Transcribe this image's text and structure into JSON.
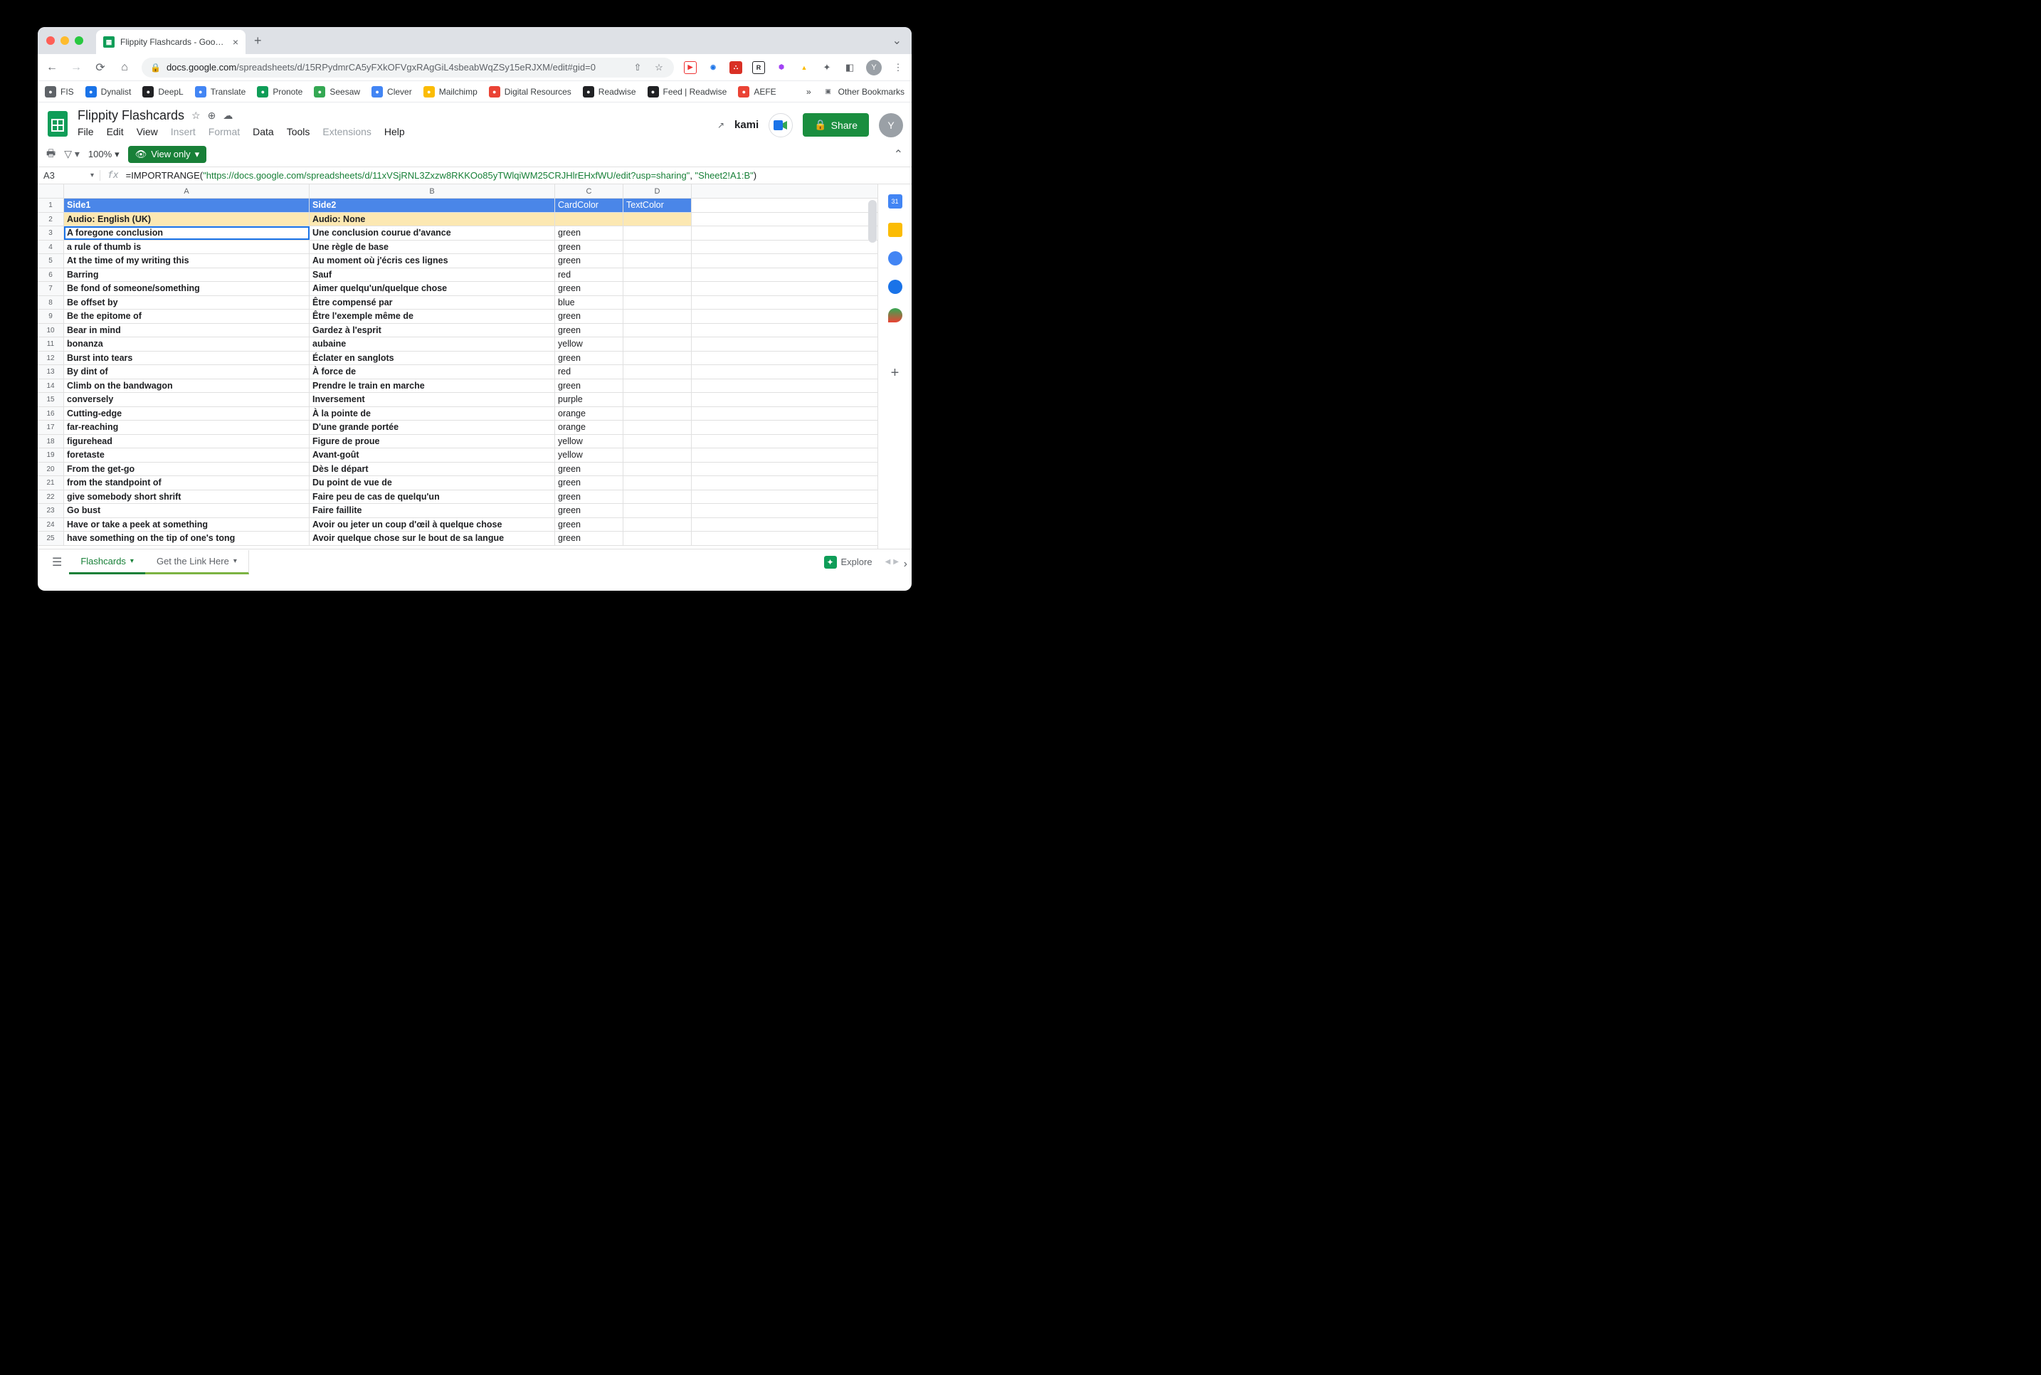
{
  "browser": {
    "tab_title": "Flippity Flashcards - Google Sh",
    "url_host": "docs.google.com",
    "url_path": "/spreadsheets/d/15RPydmrCA5yFXkOFVgxRAgGiL4sbeabWqZSy15eRJXM/edit#gid=0",
    "bookmarks": [
      "FIS",
      "Dynalist",
      "DeepL",
      "Translate",
      "Pronote",
      "Seesaw",
      "Clever",
      "Mailchimp",
      "Digital Resources",
      "Readwise",
      "Feed | Readwise",
      "AEFE"
    ],
    "bookmarks_more": "»",
    "other_bookmarks": "Other Bookmarks",
    "avatar": "Y"
  },
  "sheets": {
    "doc_title": "Flippity Flashcards",
    "menus": [
      "File",
      "Edit",
      "View",
      "Insert",
      "Format",
      "Data",
      "Tools",
      "Extensions",
      "Help"
    ],
    "menus_disabled": [
      "Insert",
      "Format",
      "Extensions"
    ],
    "kami": "kami",
    "share": "Share",
    "zoom": "100%",
    "view_only": "View only",
    "namebox": "A3",
    "formula_prefix": "=IMPORTRANGE(",
    "formula_str1": "\"https://docs.google.com/spreadsheets/d/11xVSjRNL3Zxzw8RKKOo85yTWlqiWM25CRJHlrEHxfWU/edit?usp=sharing\"",
    "formula_sep": ", ",
    "formula_str2": "\"Sheet2!A1:B\"",
    "formula_suffix": ")",
    "columns": [
      "A",
      "B",
      "C",
      "D"
    ],
    "header_row": [
      "Side1",
      "Side2",
      "CardColor",
      "TextColor"
    ],
    "audio_row": [
      "Audio: English (UK)",
      "Audio: None",
      "",
      ""
    ],
    "rows": [
      [
        "A foregone conclusion",
        "Une conclusion courue d'avance",
        "green",
        ""
      ],
      [
        "a rule of thumb is",
        "Une règle de base",
        "green",
        ""
      ],
      [
        "At the time of my writing this",
        "Au moment où j'écris ces lignes",
        "green",
        ""
      ],
      [
        "Barring",
        "Sauf",
        "red",
        ""
      ],
      [
        "Be fond of someone/something",
        "Aimer quelqu'un/quelque chose",
        "green",
        ""
      ],
      [
        "Be offset by",
        "Être compensé par",
        "blue",
        ""
      ],
      [
        "Be the epitome of",
        "Être l'exemple même de",
        "green",
        ""
      ],
      [
        "Bear in mind",
        "Gardez à l'esprit",
        "green",
        ""
      ],
      [
        "bonanza",
        "aubaine",
        "yellow",
        ""
      ],
      [
        "Burst into tears",
        "Éclater en sanglots",
        "green",
        ""
      ],
      [
        "By dint of",
        "À force de",
        "red",
        ""
      ],
      [
        "Climb on the bandwagon",
        "Prendre le train en marche",
        "green",
        ""
      ],
      [
        "conversely",
        "Inversement",
        "purple",
        ""
      ],
      [
        "Cutting-edge",
        "À la pointe de",
        "orange",
        ""
      ],
      [
        "far-reaching",
        "D'une grande portée",
        "orange",
        ""
      ],
      [
        "figurehead",
        "Figure de proue",
        "yellow",
        ""
      ],
      [
        "foretaste",
        "Avant-goût",
        "yellow",
        ""
      ],
      [
        "From the get-go",
        "Dès le départ",
        "green",
        ""
      ],
      [
        "from the standpoint of",
        "Du point de vue de",
        "green",
        ""
      ],
      [
        "give somebody short shrift",
        "Faire peu de cas de quelqu'un",
        "green",
        ""
      ],
      [
        "Go bust",
        "Faire faillite",
        "green",
        ""
      ],
      [
        "Have or take a peek at something",
        "Avoir ou jeter un coup d'œil à quelque chose",
        "green",
        ""
      ],
      [
        "have something on the tip of one's tong",
        "Avoir quelque chose sur le bout de sa langue",
        "green",
        ""
      ]
    ],
    "sheet_tabs": [
      "Flashcards",
      "Get the Link Here"
    ],
    "active_sheet": "Flashcards",
    "explore": "Explore"
  }
}
